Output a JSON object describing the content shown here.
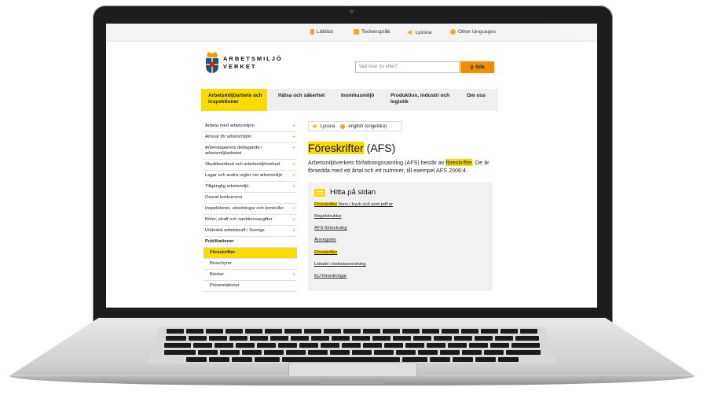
{
  "topbar": {
    "links": [
      {
        "label": "Lättläst",
        "icon": "easy-read-icon"
      },
      {
        "label": "Teckenspråk",
        "icon": "sign-language-icon"
      },
      {
        "label": "Lyssna",
        "icon": "speaker-icon"
      },
      {
        "label": "Other languages",
        "icon": "globe-icon"
      }
    ]
  },
  "logo": {
    "line1": "ARBETSMILJÖ",
    "line2": "VERKET"
  },
  "search": {
    "placeholder": "Vad letar du efter?",
    "button_label": "Sök"
  },
  "nav": {
    "items": [
      {
        "label": "Arbetsmiljöarbete och inspektioner",
        "active": true
      },
      {
        "label": "Hälsa och säkerhet"
      },
      {
        "label": "Inomhusmiljö"
      },
      {
        "label": "Produktion, industri och logistik"
      },
      {
        "label": "Om oss"
      }
    ]
  },
  "sidebar": {
    "items": [
      {
        "label": "Arbeta med arbetsmiljön",
        "plus": "+"
      },
      {
        "label": "Ansvar för arbetsmiljön",
        "plus": "+"
      },
      {
        "label": "Arbetstagarens deltagande i arbetsmiljöarbetet",
        "plus": "+"
      },
      {
        "label": "Skyddsombud och arbetsmiljöombud",
        "plus": "+"
      },
      {
        "label": "Lagar och andra regler om arbetsmiljö",
        "plus": "+"
      },
      {
        "label": "Tillgänglig arbetsmiljö",
        "plus": "+"
      },
      {
        "label": "Osund konkurrens",
        "plus": ""
      },
      {
        "label": "Inspektioner, utredningar och kontroller",
        "plus": "+"
      },
      {
        "label": "Böter, straff och sanktionsavgifter",
        "plus": "+"
      },
      {
        "label": "Utländsk arbetskraft i Sverige",
        "plus": "+"
      },
      {
        "label": "Publikationer",
        "plus": "",
        "kind": "head"
      },
      {
        "label": "Föreskrifter",
        "plus": "",
        "kind": "active"
      },
      {
        "label": "Broschyrer",
        "plus": "",
        "kind": "sub"
      },
      {
        "label": "Böcker",
        "plus": "+",
        "kind": "sub"
      },
      {
        "label": "Presentationer",
        "plus": "",
        "kind": "sub"
      }
    ]
  },
  "content": {
    "listen_label": "Lyssna",
    "english_label": "english (engelska)",
    "title_highlight": "Föreskrifter",
    "title_rest": " (AFS)",
    "intro_part1": "Arbetsmiljöverkets författningssamling (AFS) består av ",
    "intro_highlight": "föreskrifter",
    "intro_part2": ". De är försedda med ett årtal och ett nummer, till exempel AFS 2006:4.",
    "toc_title": "Hitta på sidan",
    "toc_links": [
      {
        "label": "Föreskrifter finns i tryck och som pdf:er",
        "highlight_word": "Föreskrifter"
      },
      {
        "label": "Regelstruktur"
      },
      {
        "label": "AFS-förteckning"
      },
      {
        "label": "Årsregister"
      },
      {
        "label": "Föreskrifter",
        "highlight": true
      },
      {
        "label": "Listade i bokstavsordning"
      },
      {
        "label": "EU-förordningar"
      }
    ]
  },
  "colors": {
    "accent_yellow": "#f8dc00",
    "search_orange": "#f28c00",
    "icon_orange": "#f7a41c"
  }
}
